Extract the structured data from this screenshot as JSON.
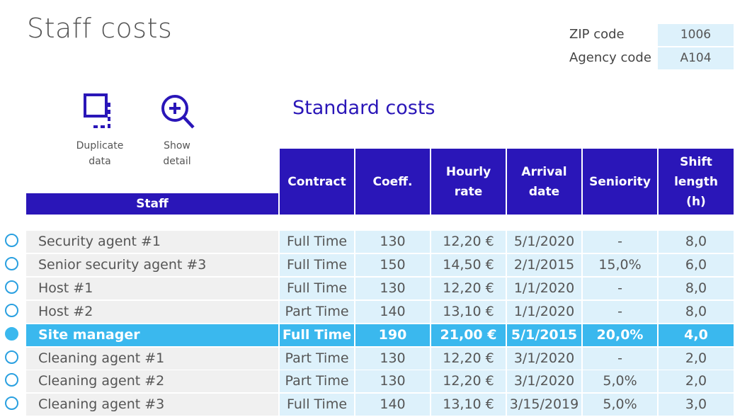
{
  "page_title": "Staff costs",
  "meta": {
    "zip_label": "ZIP code",
    "zip_value": "1006",
    "agency_label": "Agency code",
    "agency_value": "A104"
  },
  "actions": {
    "duplicate_line1": "Duplicate",
    "duplicate_line2": "data",
    "detail_line1": "Show",
    "detail_line2": "detail"
  },
  "section_title": "Standard costs",
  "colors": {
    "header": "#2a16b8",
    "selected": "#3ab8ee",
    "input_cell": "#ddf1fb"
  },
  "table": {
    "headers": {
      "staff": "Staff",
      "contract": "Contract",
      "coeff": "Coeff.",
      "hourly_rate_1": "Hourly",
      "hourly_rate_2": "rate",
      "arrival_date_1": "Arrival",
      "arrival_date_2": "date",
      "seniority": "Seniority",
      "shift_length_1": "Shift length",
      "shift_length_2": "(h)"
    },
    "rows": [
      {
        "name": "Security agent #1",
        "contract": "Full Time",
        "coeff": "130",
        "rate": "12,20 €",
        "arrival": "5/1/2020",
        "seniority": "-",
        "shift": "8,0"
      },
      {
        "name": "Senior security agent #3",
        "contract": "Full Time",
        "coeff": "150",
        "rate": "14,50 €",
        "arrival": "2/1/2015",
        "seniority": "15,0%",
        "shift": "6,0"
      },
      {
        "name": "Host #1",
        "contract": "Full Time",
        "coeff": "130",
        "rate": "12,20 €",
        "arrival": "1/1/2020",
        "seniority": "-",
        "shift": "8,0"
      },
      {
        "name": "Host #2",
        "contract": "Part Time",
        "coeff": "140",
        "rate": "13,10 €",
        "arrival": "1/1/2020",
        "seniority": "-",
        "shift": "8,0"
      },
      {
        "name": "Site manager",
        "contract": "Full Time",
        "coeff": "190",
        "rate": "21,00 €",
        "arrival": "5/1/2015",
        "seniority": "20,0%",
        "shift": "4,0"
      },
      {
        "name": "Cleaning agent #1",
        "contract": "Part Time",
        "coeff": "130",
        "rate": "12,20 €",
        "arrival": "3/1/2020",
        "seniority": "-",
        "shift": "2,0"
      },
      {
        "name": "Cleaning agent #2",
        "contract": "Part Time",
        "coeff": "130",
        "rate": "12,20 €",
        "arrival": "3/1/2020",
        "seniority": "5,0%",
        "shift": "2,0"
      },
      {
        "name": "Cleaning agent #3",
        "contract": "Full Time",
        "coeff": "140",
        "rate": "13,10 €",
        "arrival": "3/15/2019",
        "seniority": "5,0%",
        "shift": "3,0"
      }
    ]
  }
}
